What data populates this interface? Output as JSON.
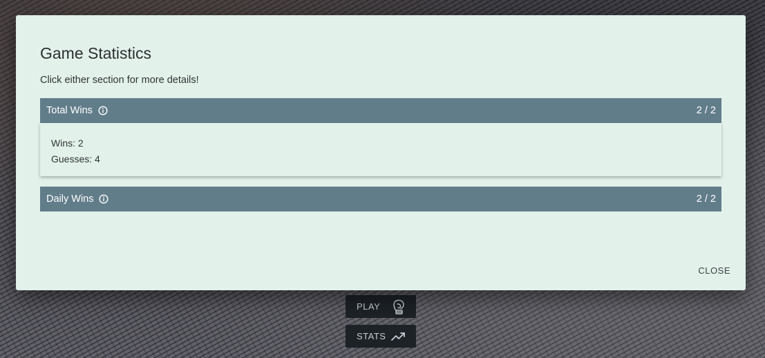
{
  "dialog": {
    "title": "Game Statistics",
    "subtitle": "Click either section for more details!",
    "close_label": "CLOSE"
  },
  "panels": [
    {
      "label": "Total Wins",
      "value": "2 / 2",
      "icon": "info-icon",
      "expanded": true,
      "details": {
        "wins": "Wins: 2",
        "guesses": "Guesses: 4"
      }
    },
    {
      "label": "Daily Wins",
      "value": "2 / 2",
      "icon": "info-icon",
      "expanded": false
    }
  ],
  "game_buttons": {
    "play_label": "PLAY",
    "play_icon": "boxing-glove-icon",
    "stats_label": "STATS",
    "stats_icon": "trending-line-icon"
  },
  "colors": {
    "dialog_bg": "#e2f1ea",
    "panel_header_bg": "#627d8a",
    "game_button_bg": "#1d2226"
  }
}
